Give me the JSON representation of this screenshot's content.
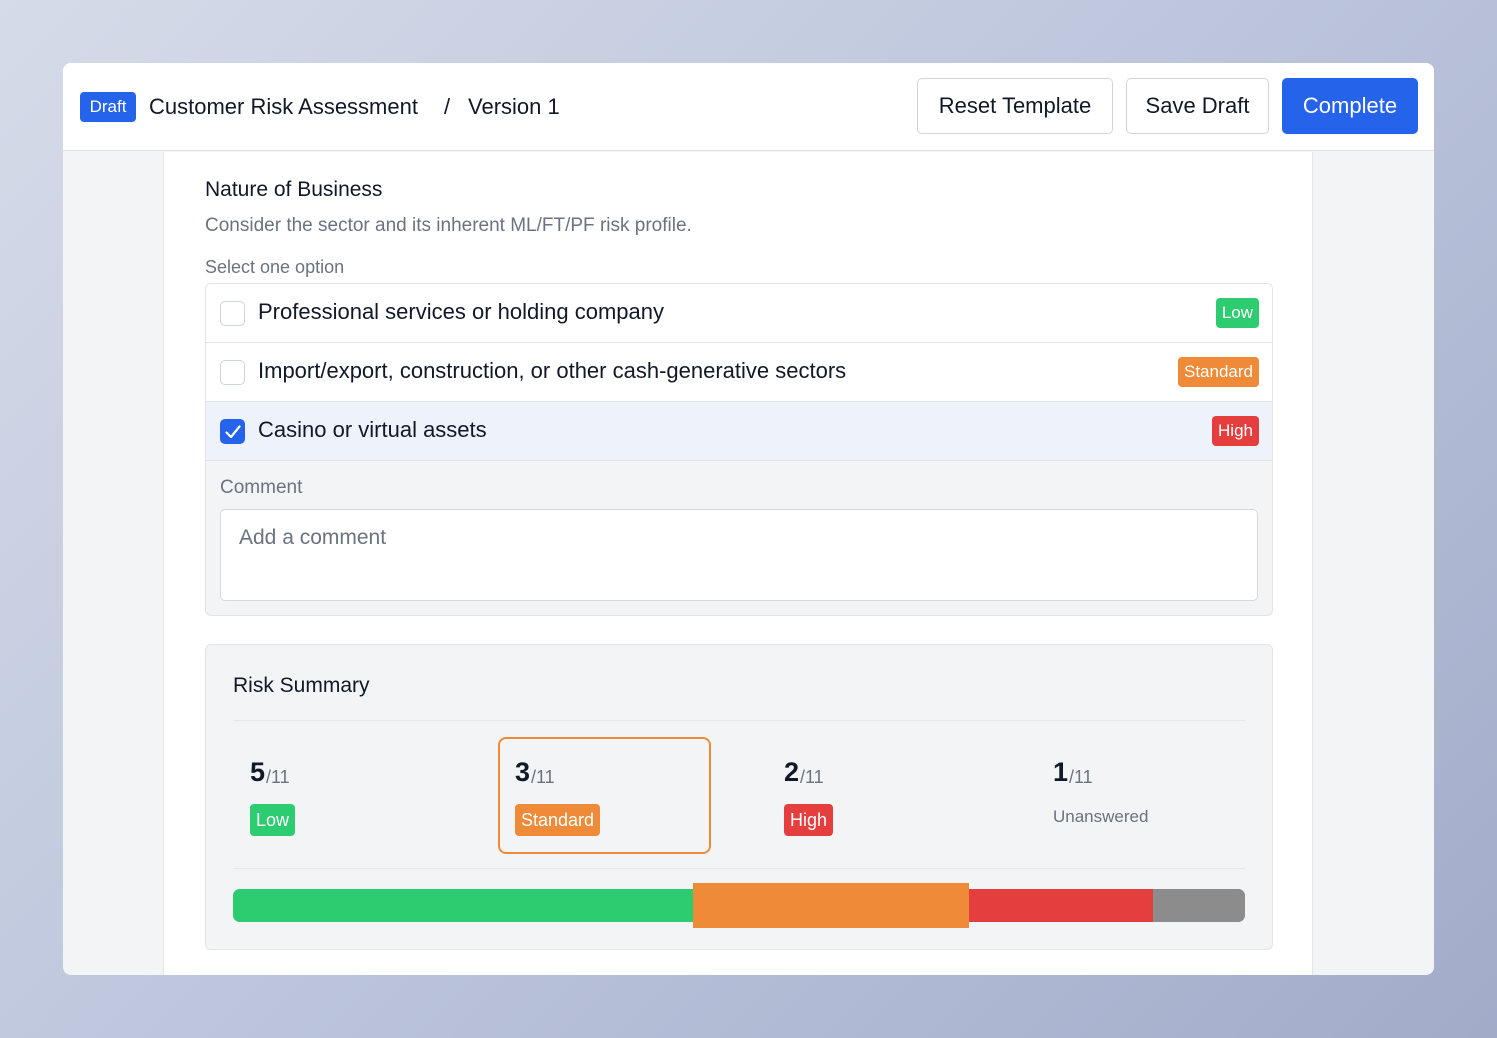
{
  "header": {
    "status_badge": "Draft",
    "title": "Customer Risk Assessment",
    "separator": "/",
    "version": "Version 1",
    "reset_label": "Reset Template",
    "save_label": "Save Draft",
    "complete_label": "Complete",
    "accent_color": "#2563eb"
  },
  "question": {
    "title": "Nature of Business",
    "description": "Consider the sector and its inherent ML/FT/PF risk profile.",
    "hint": "Select one option",
    "options": [
      {
        "label": "Professional services or holding company",
        "risk": "Low",
        "checked": false
      },
      {
        "label": "Import/export, construction, or other cash-generative sectors",
        "risk": "Standard",
        "checked": false
      },
      {
        "label": "Casino or virtual assets",
        "risk": "High",
        "checked": true
      }
    ],
    "comment_label": "Comment",
    "comment_placeholder": "Add a comment",
    "comment_value": ""
  },
  "summary": {
    "title": "Risk Summary",
    "total": 11,
    "stats": [
      {
        "count": "5",
        "total": "/11",
        "label": "Low",
        "color": "#2ecc71"
      },
      {
        "count": "3",
        "total": "/11",
        "label": "Standard",
        "color": "#ef8b38",
        "active": true
      },
      {
        "count": "2",
        "total": "/11",
        "label": "High",
        "color": "#e53e3e"
      },
      {
        "count": "1",
        "total": "/11",
        "label": "Unanswered",
        "color": "#8c8c8c"
      }
    ],
    "bar_counts": {
      "low": 5,
      "standard": 3,
      "high": 2,
      "unanswered": 1
    }
  }
}
